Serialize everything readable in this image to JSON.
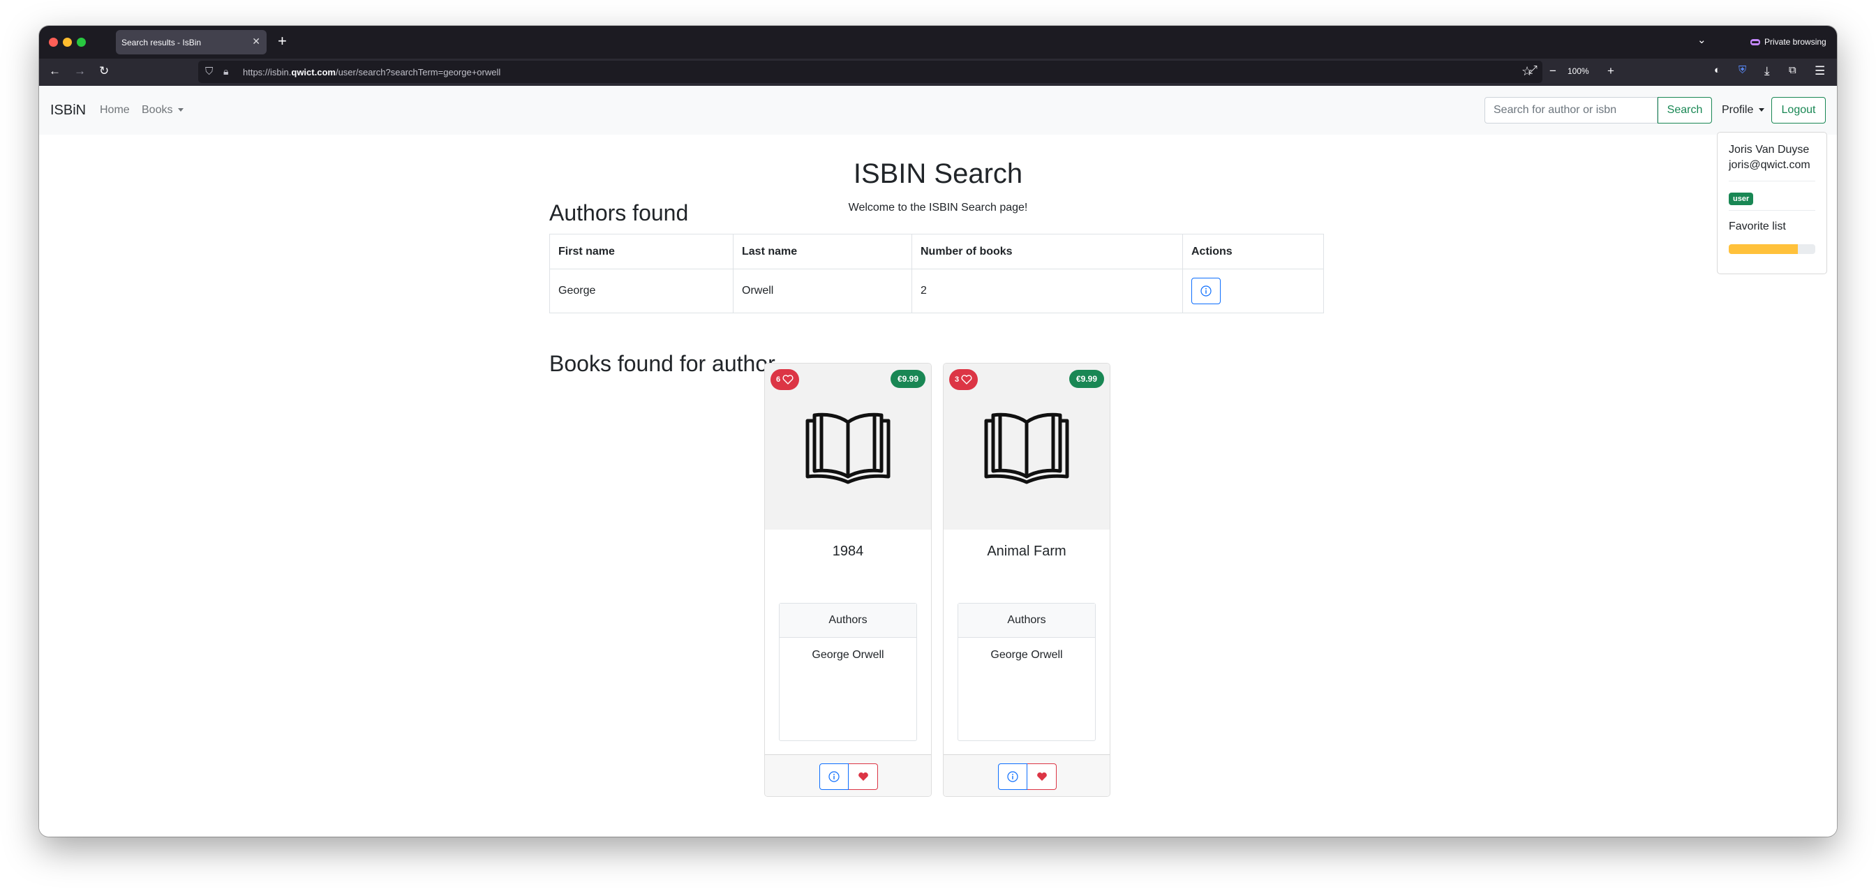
{
  "browser": {
    "tab_title": "Search results - IsBin",
    "private_label": "Private browsing",
    "url_prefix": "https://isbin.",
    "url_domain": "qwict.com",
    "url_path": "/user/search?searchTerm=george+orwell",
    "zoom_level": "100%"
  },
  "app_nav": {
    "brand": "ISBiN",
    "home": "Home",
    "books": "Books",
    "search_placeholder": "Search for author or isbn",
    "search_button": "Search",
    "profile": "Profile",
    "logout": "Logout"
  },
  "profile_menu": {
    "name": "Joris Van Duyse",
    "email": "joris@qwict.com",
    "role": "user",
    "favorite_label": "Favorite list",
    "favorite_progress": 0.8
  },
  "page": {
    "title": "ISBIN Search",
    "welcome": "Welcome to the ISBIN Search page!",
    "authors_heading": "Authors found",
    "books_heading": "Books found for author"
  },
  "authors_table": {
    "headers": [
      "First name",
      "Last name",
      "Number of books",
      "Actions"
    ],
    "rows": [
      {
        "first": "George",
        "last": "Orwell",
        "count": "2"
      }
    ]
  },
  "books": [
    {
      "likes": "6",
      "price": "€9.99",
      "title": "1984",
      "authors_header": "Authors",
      "author": "George Orwell"
    },
    {
      "likes": "3",
      "price": "€9.99",
      "title": "Animal Farm",
      "authors_header": "Authors",
      "author": "George Orwell"
    }
  ],
  "colors": {
    "success": "#198754",
    "danger": "#dc3545",
    "primary": "#0d6efd",
    "warning": "#ffc13b"
  },
  "icons": {
    "book": "open-book-icon",
    "heart_outline": "heart-outline-icon",
    "heart_filled": "heart-filled-icon",
    "info": "info-circle-icon"
  }
}
